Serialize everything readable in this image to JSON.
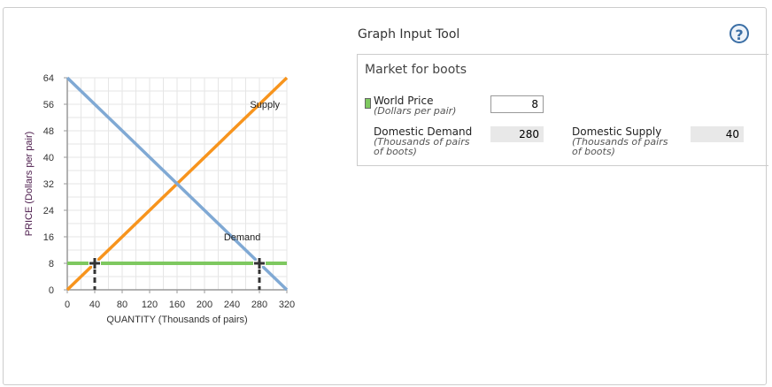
{
  "tool": {
    "title": "Graph Input Tool",
    "help_label": "?",
    "panel_title": "Market for boots",
    "world_price": {
      "label": "World Price",
      "unit": "(Dollars per pair)",
      "value": "8",
      "color": "#7ec860"
    },
    "domestic_demand": {
      "label": "Domestic Demand",
      "unit1": "(Thousands of pairs",
      "unit2": "of boots)",
      "value": "280"
    },
    "domestic_supply": {
      "label": "Domestic Supply",
      "unit1": "(Thousands of pairs",
      "unit2": "of boots)",
      "value": "40"
    }
  },
  "chart_data": {
    "type": "line",
    "xlabel": "QUANTITY (Thousands of pairs)",
    "ylabel": "PRICE (Dollars per pair)",
    "xlim": [
      0,
      320
    ],
    "ylim": [
      0,
      64
    ],
    "grid": true,
    "xticks": [
      0,
      40,
      80,
      120,
      160,
      200,
      240,
      280,
      320
    ],
    "yticks": [
      0,
      8,
      16,
      24,
      32,
      40,
      48,
      56,
      64
    ],
    "series": [
      {
        "name": "Supply",
        "color": "#f7941d",
        "points": [
          [
            0,
            0
          ],
          [
            320,
            64
          ]
        ],
        "label_at": [
          288,
          56
        ]
      },
      {
        "name": "Demand",
        "color": "#80a9d4",
        "points": [
          [
            0,
            64
          ],
          [
            320,
            0
          ]
        ],
        "label_at": [
          255,
          16
        ]
      },
      {
        "name": "World Price",
        "color": "#7ec860",
        "points": [
          [
            0,
            8
          ],
          [
            320,
            8
          ]
        ]
      }
    ],
    "markers": [
      [
        40,
        8
      ],
      [
        280,
        8
      ]
    ]
  }
}
